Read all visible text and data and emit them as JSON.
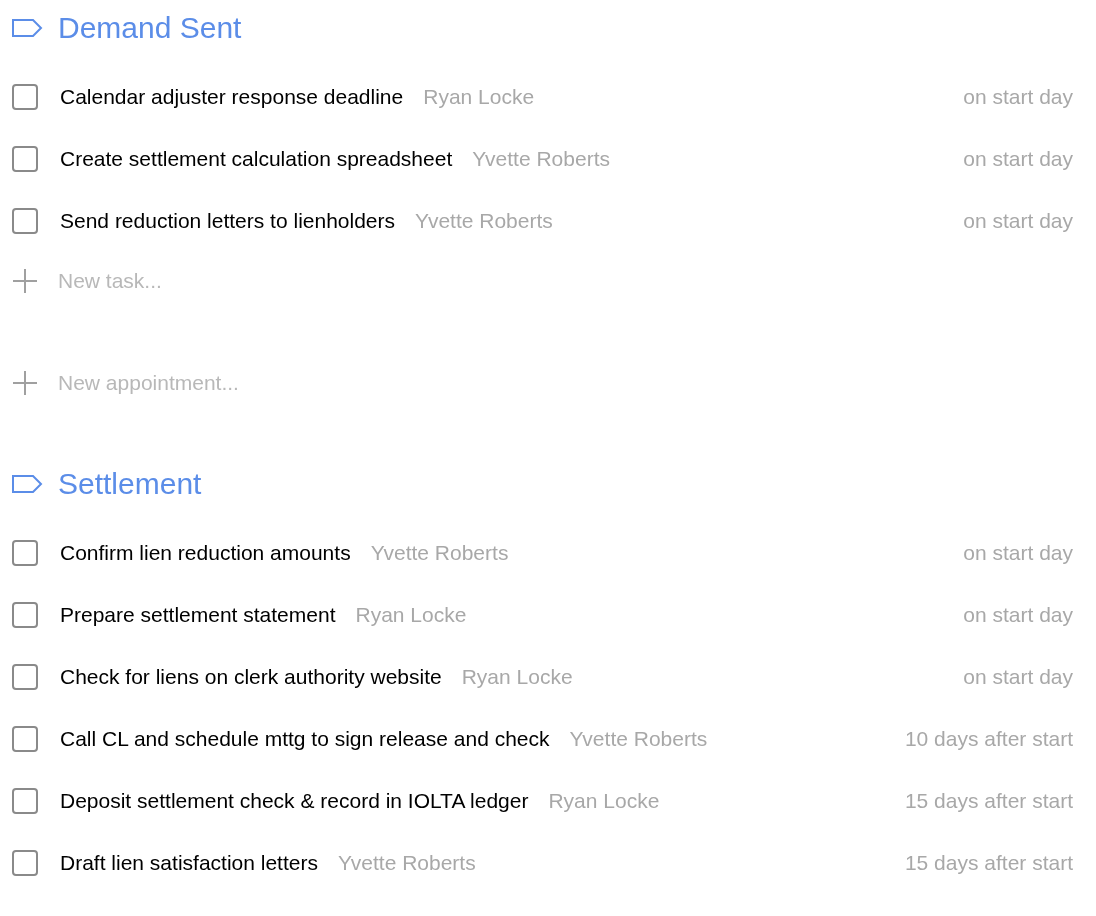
{
  "sections": [
    {
      "title": "Demand Sent",
      "tasks": [
        {
          "name": "Calendar adjuster response deadline",
          "assignee": "Ryan Locke",
          "due": "on start day",
          "checked": false
        },
        {
          "name": "Create settlement calculation spreadsheet",
          "assignee": "Yvette Roberts",
          "due": "on start day",
          "checked": false
        },
        {
          "name": "Send reduction letters to lienholders",
          "assignee": "Yvette Roberts",
          "due": "on start day",
          "checked": false
        }
      ],
      "add_rows": [
        {
          "kind": "task",
          "placeholder": "New task..."
        },
        {
          "kind": "appointment",
          "placeholder": "New appointment..."
        }
      ]
    },
    {
      "title": "Settlement",
      "tasks": [
        {
          "name": "Confirm lien reduction amounts",
          "assignee": "Yvette Roberts",
          "due": "on start day",
          "checked": false
        },
        {
          "name": "Prepare settlement statement",
          "assignee": "Ryan Locke",
          "due": "on start day",
          "checked": false
        },
        {
          "name": "Check for liens on clerk authority website",
          "assignee": "Ryan Locke",
          "due": "on start day",
          "checked": false
        },
        {
          "name": "Call CL and schedule mttg to sign release and check",
          "assignee": "Yvette Roberts",
          "due": "10 days after start",
          "checked": false
        },
        {
          "name": "Deposit settlement check & record in IOLTA ledger",
          "assignee": "Ryan Locke",
          "due": "15 days after start",
          "checked": false
        },
        {
          "name": "Draft lien satisfaction letters",
          "assignee": "Yvette Roberts",
          "due": "15 days after start",
          "checked": false
        }
      ]
    }
  ]
}
